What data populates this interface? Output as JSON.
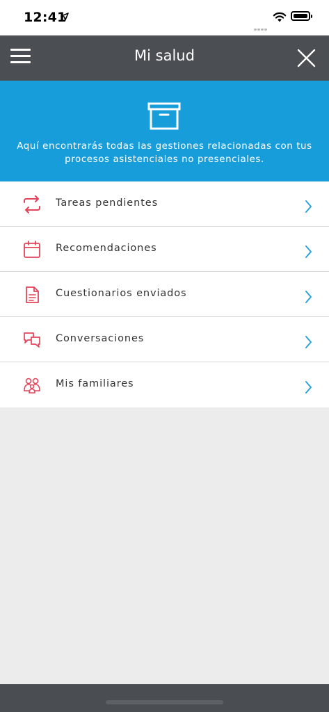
{
  "status_bar": {
    "time": "12:41"
  },
  "header": {
    "title": "Mi salud"
  },
  "banner": {
    "text": "Aquí encontrarás todas las gestiones relacionadas con tus procesos asistenciales no presenciales."
  },
  "menu": {
    "items": [
      {
        "label": "Tareas pendientes",
        "icon": "sync-arrows-icon"
      },
      {
        "label": "Recomendaciones",
        "icon": "calendar-icon"
      },
      {
        "label": "Cuestionarios enviados",
        "icon": "document-icon"
      },
      {
        "label": "Conversaciones",
        "icon": "chat-bubbles-icon"
      },
      {
        "label": "Mis familiares",
        "icon": "family-icon"
      }
    ]
  },
  "colors": {
    "header_bg": "#4b4f54",
    "banner_bg": "#179dd9",
    "icon_accent": "#e2455a",
    "chevron": "#2aa3dc",
    "page_bg": "#ececec"
  }
}
